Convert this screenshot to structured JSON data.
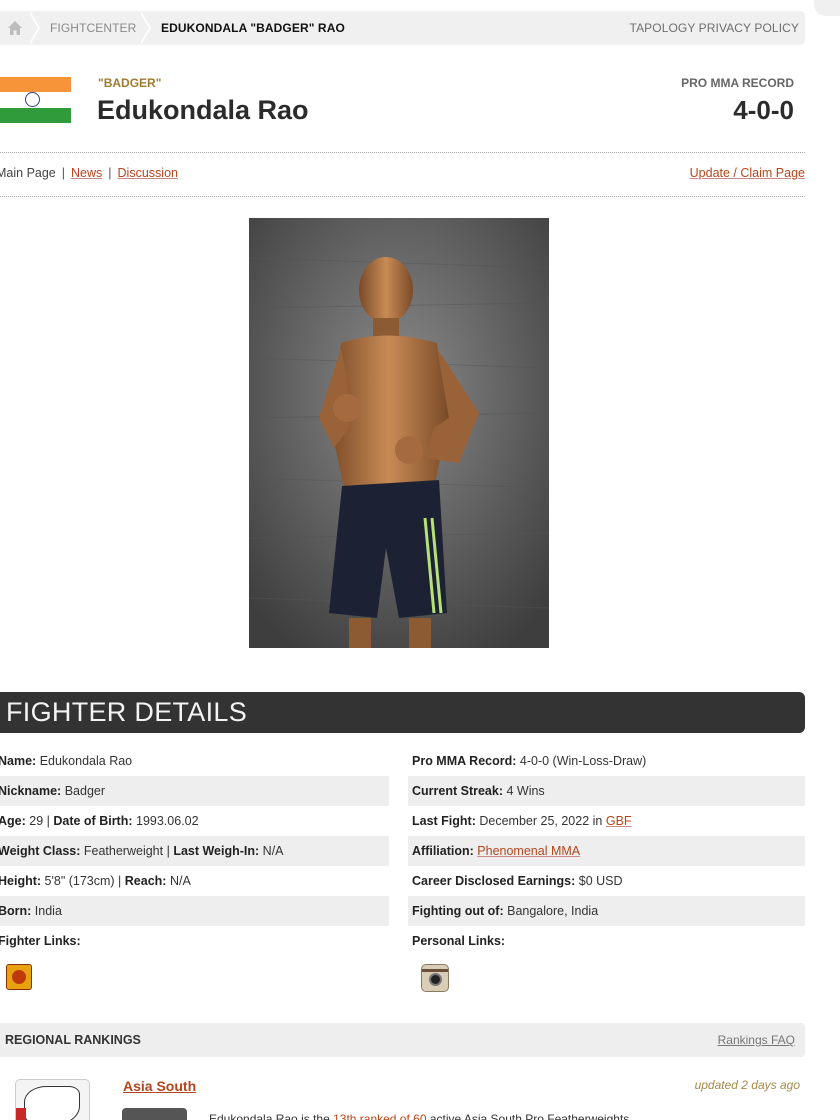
{
  "breadcrumb": {
    "home_icon": "home-icon",
    "items": [
      "FIGHTCENTER",
      "EDUKONDALA \"BADGER\" RAO"
    ],
    "right_link": "TAPOLOGY PRIVACY POLICY"
  },
  "fighter": {
    "flag": "india-flag",
    "nickname_quoted": "\"BADGER\"",
    "name": "Edukondala Rao",
    "record_label": "PRO MMA RECORD",
    "record": "4-0-0"
  },
  "page_nav": {
    "main": "Main Page",
    "news": "News",
    "discussion": "Discussion",
    "update": "Update / Claim Page"
  },
  "details": {
    "header": "FIGHTER DETAILS",
    "left": [
      {
        "label": "Name:",
        "value": " Edukondala Rao"
      },
      {
        "label": "Nickname:",
        "value": " Badger"
      },
      {
        "label": "Age:",
        "value": " 29 | ",
        "label2": "Date of Birth:",
        "value2": " 1993.06.02"
      },
      {
        "label": "Weight Class:",
        "value": " Featherweight | ",
        "label2": "Last Weigh-In:",
        "value2": " N/A"
      },
      {
        "label": "Height:",
        "value": " 5'8\" (173cm) | ",
        "label2": "Reach:",
        "value2": " N/A"
      },
      {
        "label": "Born:",
        "value": " India"
      },
      {
        "label": "Fighter Links:",
        "value": ""
      }
    ],
    "right": [
      {
        "label": "Pro MMA Record:",
        "value": " 4-0-0 (Win-Loss-Draw)"
      },
      {
        "label": "Current Streak:",
        "value": " 4 Wins"
      },
      {
        "label": "Last Fight:",
        "value": " December 25, 2022 in ",
        "link": "GBF"
      },
      {
        "label": "Affiliation:",
        "value": " ",
        "link": "Phenomenal MMA"
      },
      {
        "label": "Career Disclosed Earnings:",
        "value": " $0 USD"
      },
      {
        "label": "Fighting out of:",
        "value": " Bangalore, India"
      },
      {
        "label": "Personal Links:",
        "value": ""
      }
    ],
    "fighter_link_icon": "tapology-icon",
    "personal_link_icon": "instagram-icon"
  },
  "rankings": {
    "title": "REGIONAL RANKINGS",
    "faq": "Rankings FAQ",
    "region": "Asia South",
    "updated": "updated 2 days ago",
    "text_prefix": "Edukondala Rao is the ",
    "text_link": "13th ranked of 60",
    "text_suffix": " active Asia South Pro Featherweights."
  },
  "colors": {
    "accent_link": "#b5461c",
    "dark_header": "#333333",
    "nickname": "#a07a2e"
  }
}
